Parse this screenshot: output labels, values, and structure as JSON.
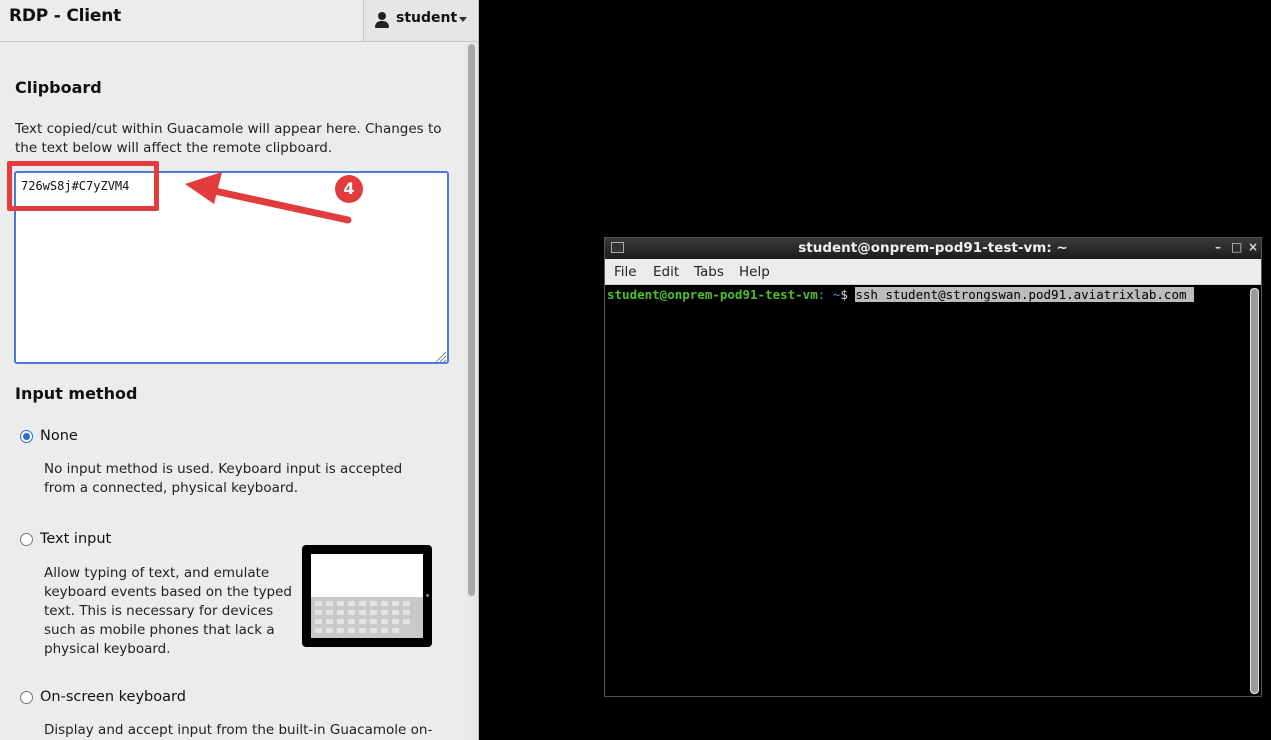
{
  "menu": {
    "title": "RDP - Client",
    "user": "student"
  },
  "clipboard": {
    "heading": "Clipboard",
    "description": "Text copied/cut within Guacamole will appear here. Changes to the text below will affect the remote clipboard.",
    "value": "726wS8j#C7yZVM4"
  },
  "annotation": {
    "badge": "4",
    "color": "#e23c3c"
  },
  "input_method": {
    "heading": "Input method",
    "options": [
      {
        "label": "None",
        "selected": true,
        "description": "No input method is used. Keyboard input is accepted from a connected, physical keyboard."
      },
      {
        "label": "Text input",
        "selected": false,
        "description": "Allow typing of text, and emulate keyboard events based on the typed text. This is necessary for devices such as mobile phones that lack a physical keyboard."
      },
      {
        "label": "On-screen keyboard",
        "selected": false,
        "description": "Display and accept input from the built-in Guacamole on-screen"
      }
    ]
  },
  "terminal": {
    "title": "student@onprem-pod91-test-vm: ~",
    "controls": [
      "–",
      "□",
      "×"
    ],
    "menu": [
      "File",
      "Edit",
      "Tabs",
      "Help"
    ],
    "prompt_user": "student@onprem-pod91-test-vm",
    "prompt_sep": ":",
    "prompt_path": " ~",
    "prompt_symbol": "$ ",
    "command": "ssh student@strongswan.pod91.aviatrixlab.com "
  }
}
